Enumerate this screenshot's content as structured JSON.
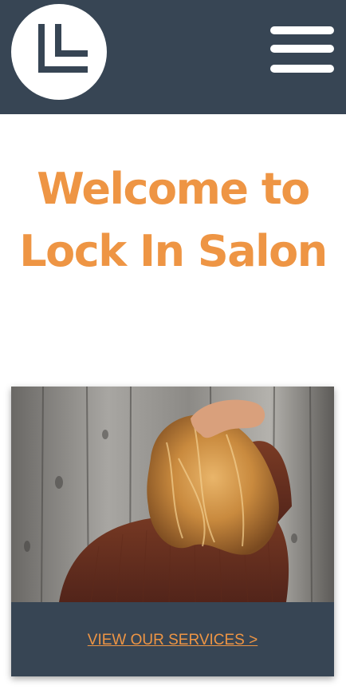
{
  "header": {
    "logo_icon": "lock-in-salon-logo-icon",
    "menu_icon": "hamburger-menu-icon",
    "background": "#374554"
  },
  "hero": {
    "title": "Welcome to Lock In Salon",
    "color": "#ee9544"
  },
  "services_card": {
    "image": "woman-with-highlighted-hair-photo",
    "link_label": "VIEW OUR SERVICES >"
  }
}
